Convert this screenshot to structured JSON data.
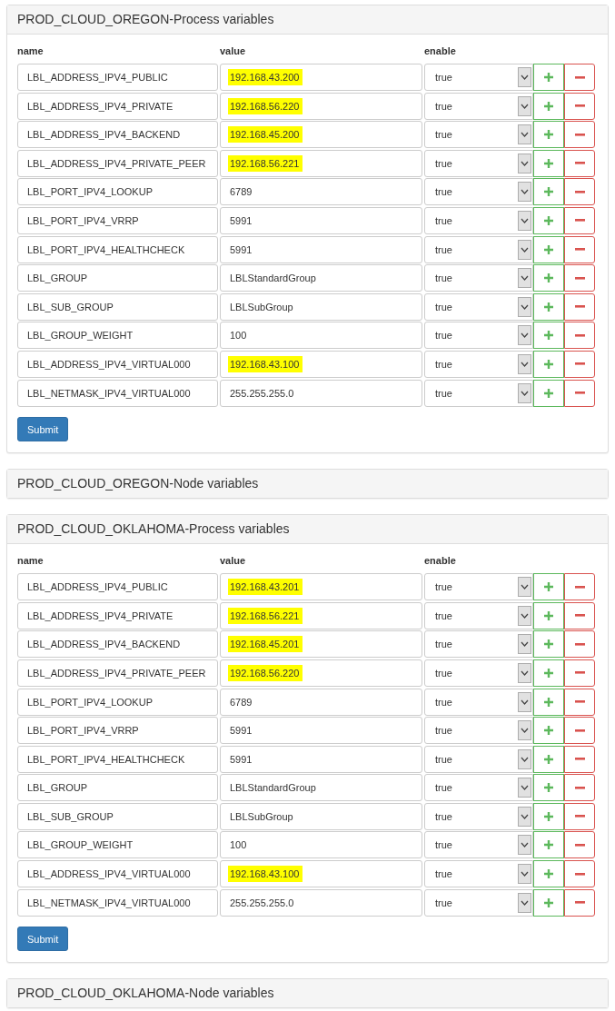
{
  "panels": [
    {
      "title": "PROD_CLOUD_OREGON-Process variables",
      "columns": [
        "name",
        "value",
        "enable"
      ],
      "rows": [
        {
          "name": "LBL_ADDRESS_IPV4_PUBLIC",
          "value": "192.168.43.200",
          "highlighted": true,
          "enable": "true"
        },
        {
          "name": "LBL_ADDRESS_IPV4_PRIVATE",
          "value": "192.168.56.220",
          "highlighted": true,
          "enable": "true"
        },
        {
          "name": "LBL_ADDRESS_IPV4_BACKEND",
          "value": "192.168.45.200",
          "highlighted": true,
          "enable": "true"
        },
        {
          "name": "LBL_ADDRESS_IPV4_PRIVATE_PEER",
          "value": "192.168.56.221",
          "highlighted": true,
          "enable": "true"
        },
        {
          "name": "LBL_PORT_IPV4_LOOKUP",
          "value": "6789",
          "highlighted": false,
          "enable": "true"
        },
        {
          "name": "LBL_PORT_IPV4_VRRP",
          "value": "5991",
          "highlighted": false,
          "enable": "true"
        },
        {
          "name": "LBL_PORT_IPV4_HEALTHCHECK",
          "value": "5991",
          "highlighted": false,
          "enable": "true"
        },
        {
          "name": "LBL_GROUP",
          "value": "LBLStandardGroup",
          "highlighted": false,
          "enable": "true"
        },
        {
          "name": "LBL_SUB_GROUP",
          "value": "LBLSubGroup",
          "highlighted": false,
          "enable": "true"
        },
        {
          "name": "LBL_GROUP_WEIGHT",
          "value": "100",
          "highlighted": false,
          "enable": "true"
        },
        {
          "name": "LBL_ADDRESS_IPV4_VIRTUAL000",
          "value": "192.168.43.100",
          "highlighted": true,
          "enable": "true"
        },
        {
          "name": "LBL_NETMASK_IPV4_VIRTUAL000",
          "value": "255.255.255.0",
          "highlighted": false,
          "enable": "true"
        }
      ],
      "submit": "Submit"
    },
    {
      "title": "PROD_CLOUD_OREGON-Node variables"
    },
    {
      "title": "PROD_CLOUD_OKLAHOMA-Process variables",
      "columns": [
        "name",
        "value",
        "enable"
      ],
      "rows": [
        {
          "name": "LBL_ADDRESS_IPV4_PUBLIC",
          "value": "192.168.43.201",
          "highlighted": true,
          "enable": "true"
        },
        {
          "name": "LBL_ADDRESS_IPV4_PRIVATE",
          "value": "192.168.56.221",
          "highlighted": true,
          "enable": "true"
        },
        {
          "name": "LBL_ADDRESS_IPV4_BACKEND",
          "value": "192.168.45.201",
          "highlighted": true,
          "enable": "true"
        },
        {
          "name": "LBL_ADDRESS_IPV4_PRIVATE_PEER",
          "value": "192.168.56.220",
          "highlighted": true,
          "enable": "true"
        },
        {
          "name": "LBL_PORT_IPV4_LOOKUP",
          "value": "6789",
          "highlighted": false,
          "enable": "true"
        },
        {
          "name": "LBL_PORT_IPV4_VRRP",
          "value": "5991",
          "highlighted": false,
          "enable": "true"
        },
        {
          "name": "LBL_PORT_IPV4_HEALTHCHECK",
          "value": "5991",
          "highlighted": false,
          "enable": "true"
        },
        {
          "name": "LBL_GROUP",
          "value": "LBLStandardGroup",
          "highlighted": false,
          "enable": "true"
        },
        {
          "name": "LBL_SUB_GROUP",
          "value": "LBLSubGroup",
          "highlighted": false,
          "enable": "true"
        },
        {
          "name": "LBL_GROUP_WEIGHT",
          "value": "100",
          "highlighted": false,
          "enable": "true"
        },
        {
          "name": "LBL_ADDRESS_IPV4_VIRTUAL000",
          "value": "192.168.43.100",
          "highlighted": true,
          "enable": "true"
        },
        {
          "name": "LBL_NETMASK_IPV4_VIRTUAL000",
          "value": "255.255.255.0",
          "highlighted": false,
          "enable": "true"
        }
      ],
      "submit": "Submit"
    },
    {
      "title": "PROD_CLOUD_OKLAHOMA-Node variables"
    }
  ]
}
